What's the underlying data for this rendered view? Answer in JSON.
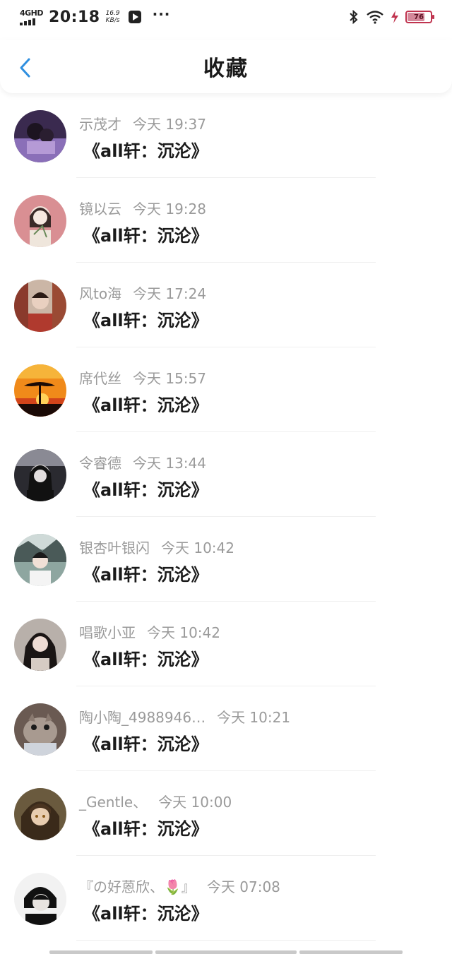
{
  "status_bar": {
    "network": "4GHD",
    "time": "20:18",
    "speed_value": "16.9",
    "speed_unit": "KB/s",
    "battery": "76",
    "battery_level": 0.76,
    "battery_color": "#c0344f"
  },
  "header": {
    "title": "收藏",
    "back_icon": "chevron-left-icon",
    "accent": "#2f8fe0"
  },
  "items": [
    {
      "user": "示茂才",
      "time": "今天 19:37",
      "title": "《all轩：沉沦》"
    },
    {
      "user": "镜以云",
      "time": "今天 19:28",
      "title": "《all轩：沉沦》"
    },
    {
      "user": "风to海",
      "time": "今天 17:24",
      "title": "《all轩：沉沦》"
    },
    {
      "user": "席代丝",
      "time": "今天 15:57",
      "title": "《all轩：沉沦》"
    },
    {
      "user": "令睿德",
      "time": "今天 13:44",
      "title": "《all轩：沉沦》"
    },
    {
      "user": "银杏叶银闪",
      "time": "今天 10:42",
      "title": "《all轩：沉沦》"
    },
    {
      "user": "唱歌小亚",
      "time": "今天 10:42",
      "title": "《all轩：沉沦》"
    },
    {
      "user": "陶小陶_4988946…",
      "time": "今天 10:21",
      "title": "《all轩：沉沦》"
    },
    {
      "user": "_Gentle、",
      "time": "今天 10:00",
      "title": "《all轩：沉沦》"
    },
    {
      "user": "『の好蒽欣、🌷』",
      "time": "今天 07:08",
      "title": "《all轩：沉沦》"
    }
  ]
}
